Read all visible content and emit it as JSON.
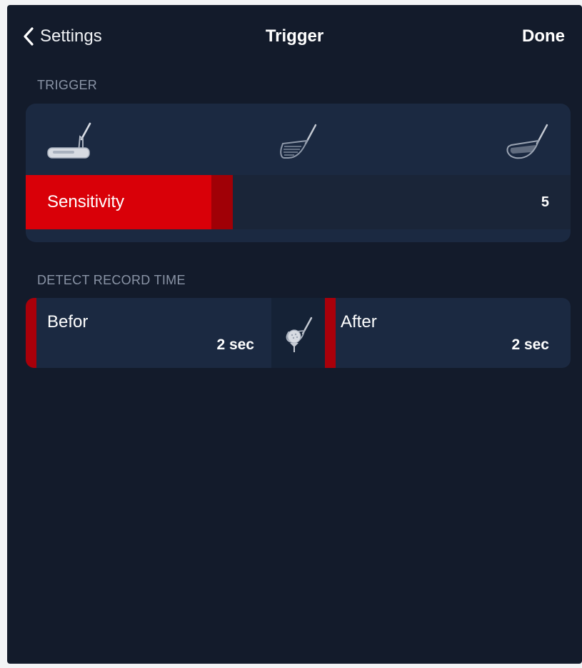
{
  "nav": {
    "back_label": "Settings",
    "title": "Trigger",
    "done_label": "Done"
  },
  "trigger_section": {
    "header": "TRIGGER",
    "club_icons": [
      "putter-icon",
      "iron-icon",
      "driver-icon"
    ],
    "sensitivity": {
      "label": "Sensitivity",
      "value": "5",
      "fill_fraction": 0.38
    }
  },
  "record_section": {
    "header": "DETECT RECORD TIME",
    "before": {
      "label": "Befor",
      "value": "2 sec"
    },
    "after": {
      "label": "After",
      "value": "2 sec"
    },
    "center_icon": "golf-club-tee-icon"
  },
  "colors": {
    "background": "#131b2b",
    "card": "#1b2941",
    "accent_red": "#d90008",
    "accent_dark_red": "#a00006",
    "section_header": "#8a94a6"
  }
}
